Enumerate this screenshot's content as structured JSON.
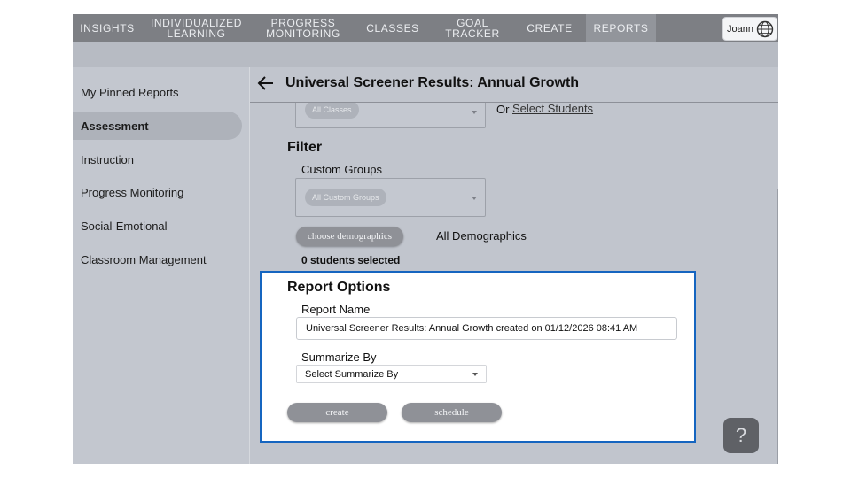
{
  "nav": {
    "items": [
      {
        "label": "INSIGHTS"
      },
      {
        "label": "INDIVIDUALIZED LEARNING"
      },
      {
        "label": "PROGRESS MONITORING"
      },
      {
        "label": "CLASSES"
      },
      {
        "label": "GOAL TRACKER"
      },
      {
        "label": "CREATE"
      },
      {
        "label": "REPORTS"
      }
    ],
    "active": "REPORTS",
    "user_name": "Joann",
    "user_icon": "globe-icon"
  },
  "sidebar": {
    "items": [
      {
        "label": "My Pinned Reports"
      },
      {
        "label": "Assessment"
      },
      {
        "label": "Instruction"
      },
      {
        "label": "Progress Monitoring"
      },
      {
        "label": "Social-Emotional"
      },
      {
        "label": "Classroom Management"
      }
    ],
    "active": "Assessment"
  },
  "header": {
    "title": "Universal Screener Results: Annual Growth",
    "back_icon": "arrow-left-icon"
  },
  "classes": {
    "chip": "All Classes",
    "or_text": "Or",
    "select_students_link": "Select Students"
  },
  "filter": {
    "heading": "Filter",
    "custom_groups_label": "Custom Groups",
    "custom_groups_chip": "All Custom Groups",
    "demographics_button": "choose demographics",
    "demographics_value": "All Demographics",
    "students_selected": "0 students selected"
  },
  "report_options": {
    "heading": "Report Options",
    "name_label": "Report Name",
    "name_value": "Universal Screener Results: Annual Growth created on 01/12/2026 08:41 AM",
    "summarize_label": "Summarize By",
    "summarize_value": "Select Summarize By",
    "create_button": "create",
    "schedule_button": "schedule"
  },
  "help": {
    "label": "?",
    "icon": "help-icon"
  },
  "colors": {
    "highlight_border": "#1565c0",
    "nav_bg": "#7d7f84",
    "overlay_bg": "#c3c7cf"
  }
}
